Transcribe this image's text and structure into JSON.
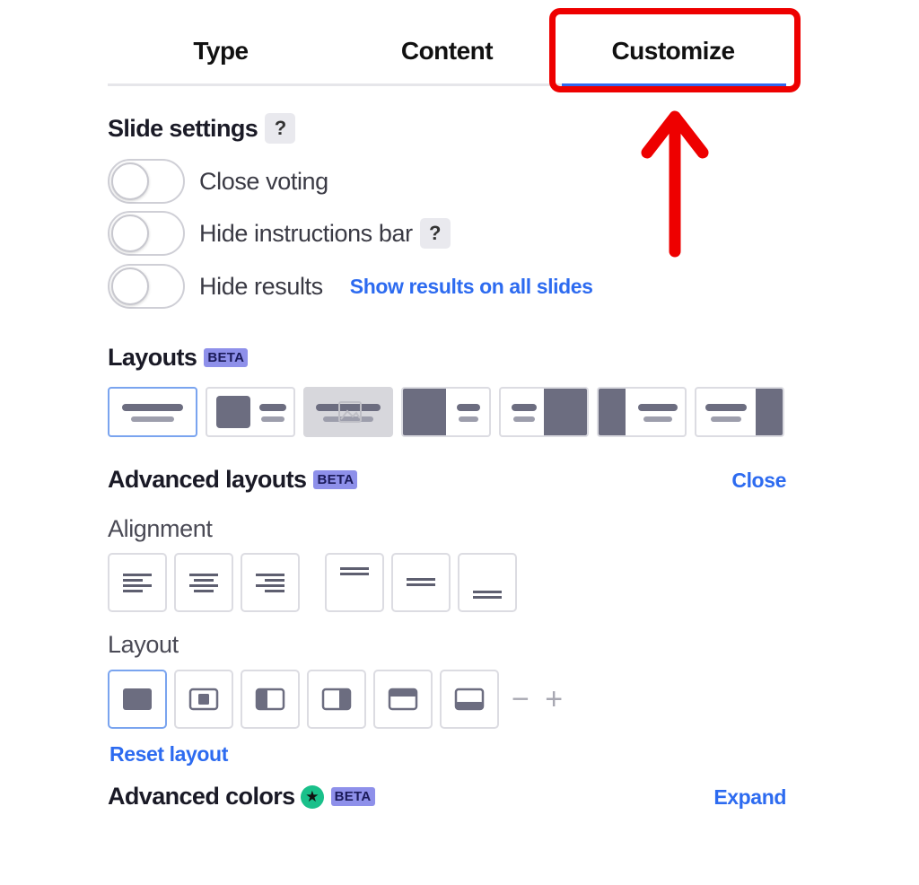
{
  "tabs": [
    {
      "label": "Type"
    },
    {
      "label": "Content"
    },
    {
      "label": "Customize",
      "active": true
    }
  ],
  "annotation": {
    "color": "#ee0000",
    "target": "Customize"
  },
  "slide_settings": {
    "title": "Slide settings",
    "help": "?",
    "toggles": [
      {
        "label": "Close voting",
        "on": false
      },
      {
        "label": "Hide instructions bar",
        "on": false,
        "help": "?"
      },
      {
        "label": "Hide results",
        "on": false
      }
    ],
    "show_results_link": "Show results on all slides"
  },
  "layouts": {
    "title": "Layouts",
    "badge": "BETA",
    "options": [
      "text-only",
      "image-left-small",
      "image-background",
      "image-left",
      "image-right",
      "image-left-full",
      "image-right-full"
    ],
    "selected": 0
  },
  "advanced_layouts": {
    "title": "Advanced layouts",
    "badge": "BETA",
    "close_link": "Close",
    "alignment_label": "Alignment",
    "alignment_options": [
      "align-left",
      "align-center",
      "align-right",
      "align-top",
      "align-middle",
      "align-bottom"
    ],
    "layout_label": "Layout",
    "layout_options": [
      "full",
      "centered",
      "left-panel",
      "right-panel",
      "top-panel",
      "bottom-panel"
    ],
    "layout_selected": 0,
    "minus_plus": "− +",
    "reset_link": "Reset layout"
  },
  "advanced_colors": {
    "title": "Advanced colors",
    "star": "★",
    "badge": "BETA",
    "expand_link": "Expand"
  },
  "colors": {
    "accent": "#3068f0",
    "link": "#2d6bf0",
    "beta_bg": "#8e90ea",
    "icon_fill": "#6c6d80",
    "premium_star": "#19c08a"
  }
}
